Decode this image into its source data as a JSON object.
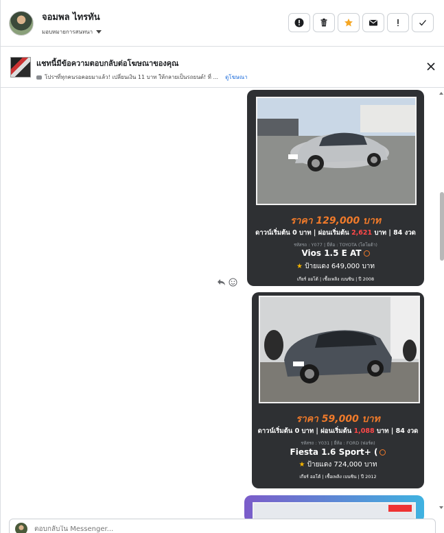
{
  "header": {
    "name": "จอมพล ไทรทัน",
    "assign_label": "มอบหมายการสนทนา",
    "actions": [
      "report-icon",
      "trash-icon",
      "star-icon",
      "mail-icon",
      "exclamation-icon",
      "check-icon"
    ]
  },
  "ad_banner": {
    "title": "แชทนี้มีข้อความตอบกลับต่อโฆษณาของคุณ",
    "preview": "โปรฯที่ทุกคนรอคอยมาแล้ว! เปลี่ยนเงิน 11 บาท ให้กลายเป็นรถยนต์! ที่ ...",
    "link": "ดูโฆษณา"
  },
  "cards": [
    {
      "price": "ราคา 129,000 บาท",
      "terms_prefix": "ดาวน์เริ่มต้น 0 บาท | ผ่อนเริ่มต้น",
      "installment": "2,621",
      "terms_suffix": "บาท | 84 งวด",
      "meta": "รหัสรถ : Y077 | ยี่ห้อ : TOYOTA (โตโยต้า)",
      "model": "Vios 1.5 E AT",
      "plate_price": "ป้ายแดง 649,000 บาท",
      "specs": "เกียร์ ออโต้   |   เชื้อเพลิง เบนซิน   |   ปี 2008"
    },
    {
      "price": "ราคา 59,000 บาท",
      "terms_prefix": "ดาวน์เริ่มต้น 0 บาท | ผ่อนเริ่มต้น",
      "installment": "1,088",
      "terms_suffix": "บาท | 84 งวด",
      "meta": "รหัสรถ : Y031 | ยี่ห้อ : FORD (ฟอร์ด)",
      "model": "Fiesta 1.6 Sport+ (",
      "plate_price": "ป้ายแดง 724,000 บาท",
      "specs": "เกียร์ ออโต้   |   เชื้อเพลิง เบนซิน   |   ปี 2012"
    }
  ],
  "composer": {
    "placeholder": "ตอบกลับใน Messenger..."
  },
  "colors": {
    "price_orange": "#f07a2a",
    "installment_red": "#ff4848",
    "card_bg": "#2e3033",
    "link_blue": "#216fdb"
  }
}
